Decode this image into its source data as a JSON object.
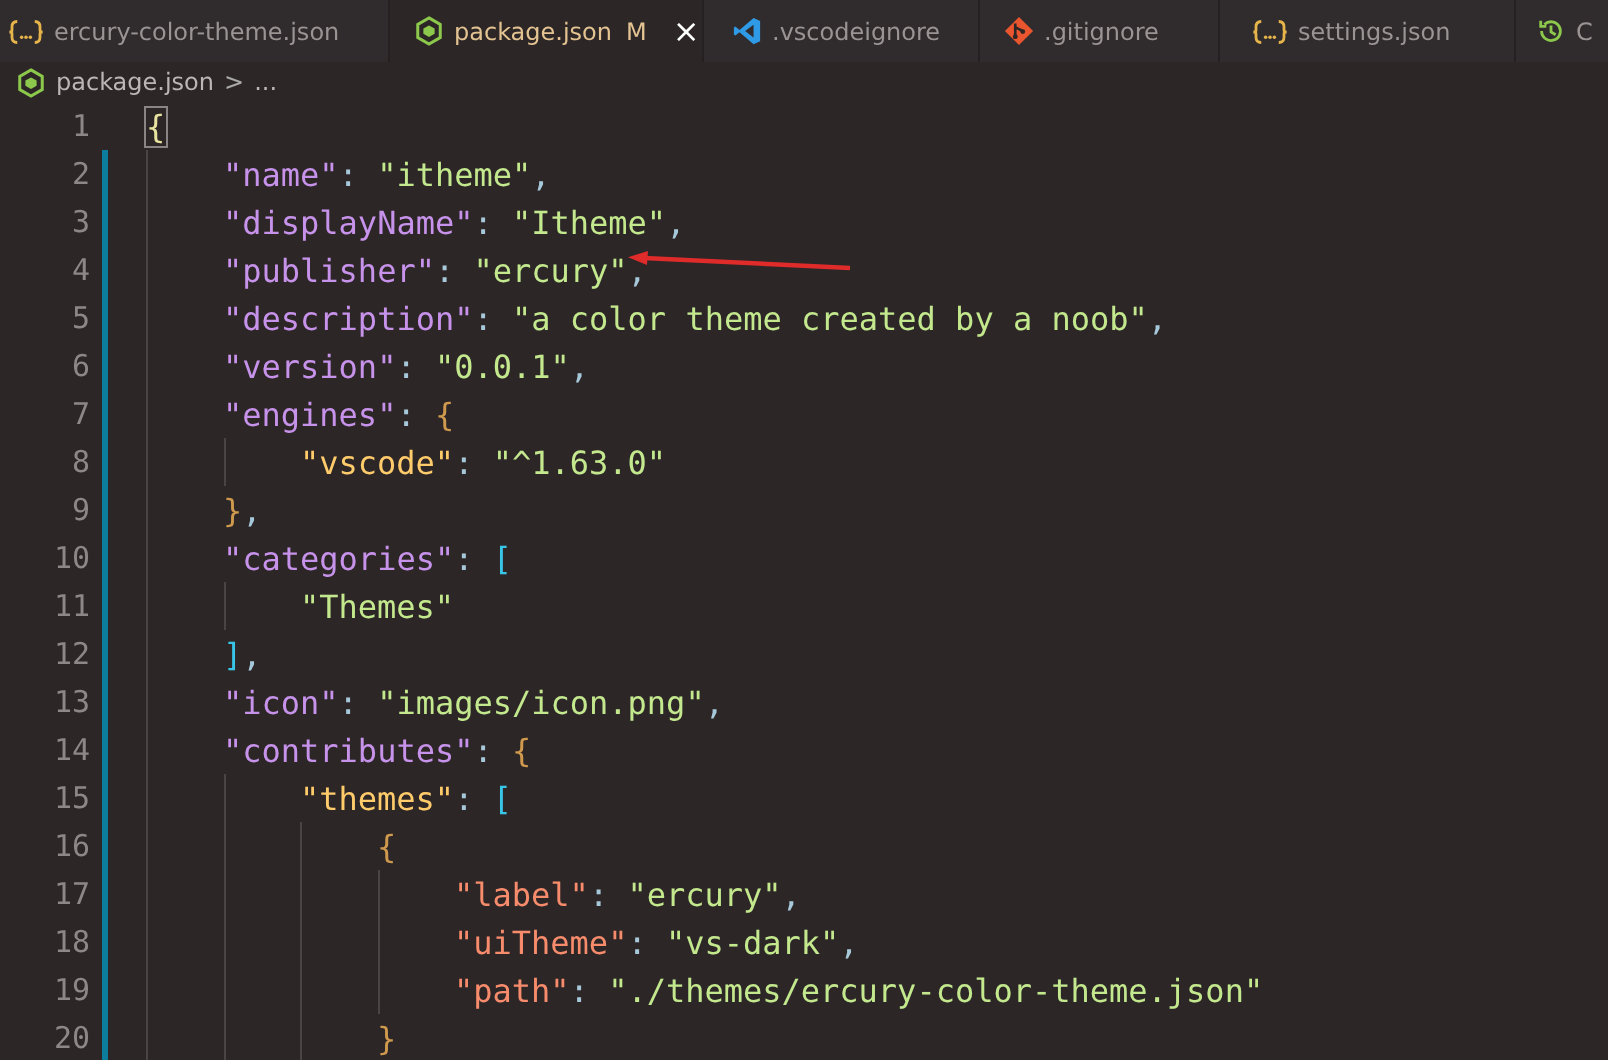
{
  "tabs": [
    {
      "label": "ercury-color-theme.json",
      "kind": "json",
      "selected": false
    },
    {
      "label": "package.json",
      "kind": "node",
      "selected": true,
      "badge": "M",
      "close": "×"
    },
    {
      "label": ".vscodeignore",
      "kind": "vscode",
      "selected": false
    },
    {
      "label": ".gitignore",
      "kind": "git",
      "selected": false
    },
    {
      "label": "settings.json",
      "kind": "json",
      "selected": false
    },
    {
      "label": "C",
      "kind": "history",
      "selected": false
    }
  ],
  "breadcrumb": {
    "file": "package.json",
    "separator": ">",
    "rest": "..."
  },
  "lines": [
    {
      "number": "1",
      "modified": false,
      "tokens": [
        {
          "kind": "brace1",
          "text": "{"
        }
      ],
      "children": [
        {
          "number": "2",
          "modified": true,
          "tokens": [
            {
              "kind": "key1",
              "text": "\"name\""
            },
            {
              "kind": "punct",
              "text": ": "
            },
            {
              "kind": "str",
              "text": "\"itheme\""
            },
            {
              "kind": "punct",
              "text": ","
            }
          ]
        },
        {
          "number": "3",
          "modified": true,
          "tokens": [
            {
              "kind": "key1",
              "text": "\"displayName\""
            },
            {
              "kind": "punct",
              "text": ": "
            },
            {
              "kind": "str",
              "text": "\"Itheme\""
            },
            {
              "kind": "punct",
              "text": ","
            }
          ]
        },
        {
          "number": "4",
          "modified": true,
          "tokens": [
            {
              "kind": "key1",
              "text": "\"publisher\""
            },
            {
              "kind": "punct",
              "text": ": "
            },
            {
              "kind": "str",
              "text": "\"ercury\""
            },
            {
              "kind": "punct",
              "text": ","
            }
          ]
        },
        {
          "number": "5",
          "modified": true,
          "tokens": [
            {
              "kind": "key1",
              "text": "\"description\""
            },
            {
              "kind": "punct",
              "text": ": "
            },
            {
              "kind": "str",
              "text": "\"a color theme created by a noob\""
            },
            {
              "kind": "punct",
              "text": ","
            }
          ]
        },
        {
          "number": "6",
          "modified": true,
          "tokens": [
            {
              "kind": "key1",
              "text": "\"version\""
            },
            {
              "kind": "punct",
              "text": ": "
            },
            {
              "kind": "str",
              "text": "\"0.0.1\""
            },
            {
              "kind": "punct",
              "text": ","
            }
          ]
        },
        {
          "number": "7",
          "modified": true,
          "tokens": [
            {
              "kind": "key1",
              "text": "\"engines\""
            },
            {
              "kind": "punct",
              "text": ": "
            },
            {
              "kind": "brace2",
              "text": "{"
            }
          ],
          "children": [
            {
              "number": "8",
              "modified": true,
              "tokens": [
                {
                  "kind": "key2",
                  "text": "\"vscode\""
                },
                {
                  "kind": "punct",
                  "text": ": "
                },
                {
                  "kind": "str",
                  "text": "\"^1.63.0\""
                }
              ]
            }
          ]
        },
        {
          "number": "9",
          "modified": true,
          "tokens": [
            {
              "kind": "brace2",
              "text": "}"
            },
            {
              "kind": "punct",
              "text": ","
            }
          ]
        },
        {
          "number": "10",
          "modified": true,
          "tokens": [
            {
              "kind": "key1",
              "text": "\"categories\""
            },
            {
              "kind": "punct",
              "text": ": "
            },
            {
              "kind": "bracket",
              "text": "["
            }
          ],
          "children": [
            {
              "number": "11",
              "modified": true,
              "tokens": [
                {
                  "kind": "str",
                  "text": "\"Themes\""
                }
              ]
            }
          ]
        },
        {
          "number": "12",
          "modified": true,
          "tokens": [
            {
              "kind": "bracket",
              "text": "]"
            },
            {
              "kind": "punct",
              "text": ","
            }
          ]
        },
        {
          "number": "13",
          "modified": true,
          "tokens": [
            {
              "kind": "key1",
              "text": "\"icon\""
            },
            {
              "kind": "punct",
              "text": ": "
            },
            {
              "kind": "str",
              "text": "\"images/icon.png\""
            },
            {
              "kind": "punct",
              "text": ","
            }
          ]
        },
        {
          "number": "14",
          "modified": true,
          "tokens": [
            {
              "kind": "key1",
              "text": "\"contributes\""
            },
            {
              "kind": "punct",
              "text": ": "
            },
            {
              "kind": "brace2",
              "text": "{"
            }
          ],
          "children": [
            {
              "number": "15",
              "modified": true,
              "tokens": [
                {
                  "kind": "key2",
                  "text": "\"themes\""
                },
                {
                  "kind": "punct",
                  "text": ": "
                },
                {
                  "kind": "bracket",
                  "text": "["
                }
              ],
              "children": [
                {
                  "number": "16",
                  "modified": true,
                  "tokens": [
                    {
                      "kind": "brace3",
                      "text": "{"
                    }
                  ],
                  "children": [
                    {
                      "number": "17",
                      "modified": true,
                      "tokens": [
                        {
                          "kind": "key3",
                          "text": "\"label\""
                        },
                        {
                          "kind": "punct",
                          "text": ": "
                        },
                        {
                          "kind": "str",
                          "text": "\"ercury\""
                        },
                        {
                          "kind": "punct",
                          "text": ","
                        }
                      ]
                    },
                    {
                      "number": "18",
                      "modified": true,
                      "tokens": [
                        {
                          "kind": "key3",
                          "text": "\"uiTheme\""
                        },
                        {
                          "kind": "punct",
                          "text": ": "
                        },
                        {
                          "kind": "str",
                          "text": "\"vs-dark\""
                        },
                        {
                          "kind": "punct",
                          "text": ","
                        }
                      ]
                    },
                    {
                      "number": "19",
                      "modified": true,
                      "tokens": [
                        {
                          "kind": "key3",
                          "text": "\"path\""
                        },
                        {
                          "kind": "punct",
                          "text": ": "
                        },
                        {
                          "kind": "str",
                          "text": "\"./themes/ercury-color-theme.json\""
                        }
                      ]
                    }
                  ]
                },
                {
                  "number": "20",
                  "modified": true,
                  "tokens": [
                    {
                      "kind": "brace3",
                      "text": "}"
                    }
                  ]
                }
              ]
            }
          ]
        }
      ]
    }
  ]
}
